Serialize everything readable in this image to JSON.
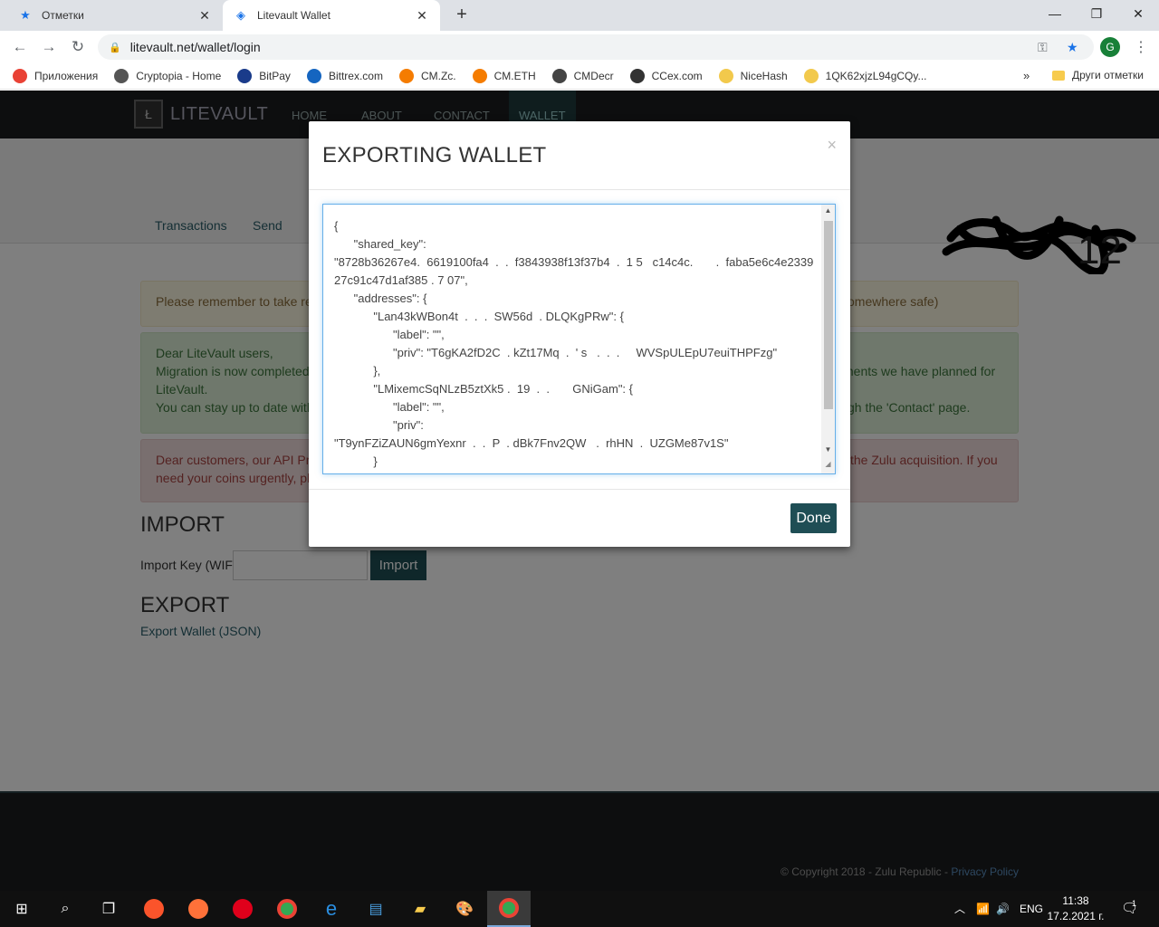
{
  "browser": {
    "tabs": [
      {
        "title": "Отметки",
        "icon": "star-icon"
      },
      {
        "title": "Litevault Wallet",
        "icon": "litevault-icon"
      }
    ],
    "new_tab": "+",
    "url": "litevault.net/wallet/login",
    "profile_initial": "G",
    "bookmarks": [
      {
        "label": "Приложения",
        "color": "#e94235"
      },
      {
        "label": "Cryptopia - Home",
        "color": "#555555"
      },
      {
        "label": "BitPay",
        "color": "#1a3b8a"
      },
      {
        "label": "Bittrex.com",
        "color": "#1565c0"
      },
      {
        "label": "CM.Zc.",
        "color": "#f57c00"
      },
      {
        "label": "CM.ETH",
        "color": "#f57c00"
      },
      {
        "label": "CMDecr",
        "color": "#444444"
      },
      {
        "label": "CCex.com",
        "color": "#333333"
      },
      {
        "label": "NiceHash",
        "color": "#f2c94c"
      },
      {
        "label": "1QK62xjzL94gCQy...",
        "color": "#f2c94c"
      }
    ],
    "bookmarks_more": "»",
    "other_bookmarks": "Други отметки"
  },
  "site": {
    "logo_text": "LITEVAULT",
    "nav": [
      "HOME",
      "ABOUT",
      "CONTACT",
      "WALLET"
    ],
    "subnav": [
      "Transactions",
      "Send"
    ],
    "alert_warn": "Please remember to take reg",
    "alert_warn_tail": "omewhere safe)",
    "alert_info_lines": [
      "Dear LiteVault users,",
      "Migration is now completed a",
      "LiteVault.",
      "You can stay up to date with"
    ],
    "alert_info_tail1": "ments we have planned for",
    "alert_info_tail2": "gh the 'Contact' page.",
    "alert_err_lines": [
      "Dear customers, our API Prov",
      "need your coins urgently, plea"
    ],
    "alert_err_tail": "the Zulu acquisition. If you",
    "import_heading": "IMPORT",
    "import_label": "Import Key (WIF)",
    "import_button": "Import",
    "export_heading": "EXPORT",
    "export_link": "Export Wallet (JSON)",
    "footer_copy": "© Copyright 2018 - Zulu Republic - ",
    "footer_privacy": "Privacy Policy"
  },
  "modal": {
    "title": "EXPORTING WALLET",
    "close": "×",
    "json_content": "{\n      \"shared_key\":\n\"8728b36267e4.  6619100fa4  .  .  f3843938f13f37b4  .  1 5   c14c4c.       .  faba5e6c4e233927c91c47d1af385 . 7 07\",\n      \"addresses\": {\n            \"Lan43kWBon4t  .  .  .  SW56d  . DLQKgPRw\": {\n                  \"label\": \"\",\n                  \"priv\": \"T6gKA2fD2C  . kZt17Mq  .  ' s   .  .  .     WVSpULEpU7euiTHPFzg\"\n            },\n            \"LMixemcSqNLzB5ztXk5 .  19  .  .       GNiGam\": {\n                  \"label\": \"\",\n                  \"priv\":\n\"T9ynFZiZAUN6gmYexnr  .  .  P  . dBk7Fnv2QW   .  rhHN  .  UZGMe87v1S\"\n            }",
    "done_button": "Done"
  },
  "taskbar": {
    "lang": "ENG",
    "time": "11:38",
    "date": "17.2.2021 г.",
    "notifications": "1"
  }
}
